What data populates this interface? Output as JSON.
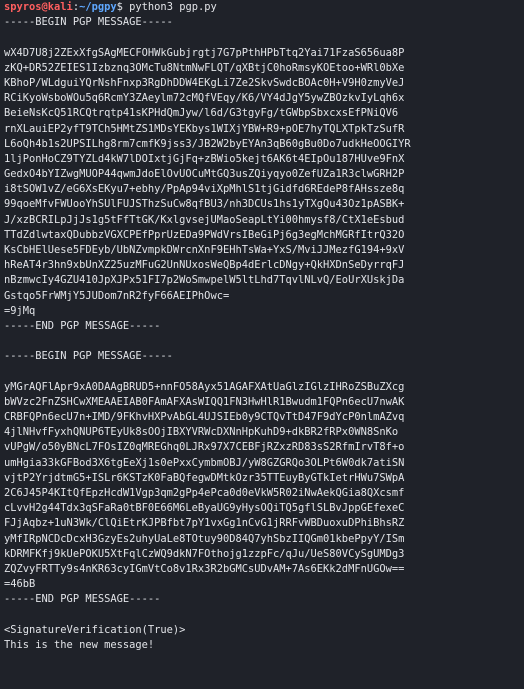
{
  "prompt": {
    "user_host": "spyros@kali",
    "separator": ":",
    "path": "~/pgpy",
    "dollar": "$ ",
    "command": "python3 pgp.py"
  },
  "message_block": {
    "begin": "-----BEGIN PGP MESSAGE-----",
    "lines": [
      "wX4D7U8j2ZExXfgSAgMECFOHWkGubjrgtj7G7pPthHPbTtq2Yai71FzaS656ua8P",
      "zKQ+DR52ZEIES1Izbznq3OMcTu8NtmNwFLQT/qXBtjC0hoRmsyKOEtoo+WRl0bXe",
      "KBhoP/WLdguiYQrNshFnxp3RgDhDDW4EKgLi7Ze2SkvSwdcBOAc0H+V9H0zmyVeJ",
      "RCiKyoWsboWOu5q6RcmY3ZAeylm72cMQfVEqy/K6/VY4dJgY5ywZBOzkvIyLqh6x",
      "BeieNsKcQ51RCQtrqtp41sKPHdQmJyw/l6d/G3tgyFg/tGWbpSbxcxsEfPNiQV6",
      "rnXLauiEP2yfT9TCh5HMtZS1MDsYEKbys1WIXjYBW+R9+pOE7hyTQLXTpkTzSufR",
      "L6oQh4b1s2UPSILhg8rm7cmfK9jss3/JB2W2byEYAn3qB60gBu0Do7udkHeOOGIYR",
      "1ljPonHoCZ9TYZLd4kW7lDOIxtjGjFq+zBWio5kejt6AK6t4EIpOu187HUve9FnX",
      "GedxO4bYIZwgMUOP44qwmJdoElOvUOCuMtGQ3usZQiyqyo0ZefUZa1R3clwGRH2P",
      "i8tSOW1vZ/eG6XsEKyu7+ebhy/PpAp94viXpMhlS1tjGidfd6REdeP8fAHssze8q",
      "99qoeMfvFWUooYhSUlFUJSThzSuCw8qfBU3/nh3DCUs1hs1yTXgQu43Oz1pASBK+",
      "J/xzBCRILpJjJs1g5tFfTtGK/KxlgvsejUMaoSeapLtYi00hmysf8/CtX1eEsbud",
      "TTdZdlwtaxQDubbzVGXCPEfPprUzEDa9PWdVrsIBeGiPj6g3egMchMGRfItrQ32O",
      "KsCbHElUese5FDEyb/UbNZvmpkDWrcnXnF9EHhTsWa+YxS/MviJJMezfG194+9xV",
      "hReAT4r3hn9xbUnXZ25uzMFuG2UnNUxosWeQBp4dErlcDNgy+QkHXDnSeDyrrqFJ",
      "nBzmwcIy4GZU410JpXJPx51FI7p2WoSmwpelW5ltLhd7TqvlNLvQ/EoUrXUskjDa",
      "Gstqo5FrWMjY5JUDom7nR2fyF66AEIPhOwc=",
      "=9jMq"
    ],
    "end": "-----END PGP MESSAGE-----"
  },
  "signature_block": {
    "begin": "-----BEGIN PGP MESSAGE-----",
    "lines": [
      "yMGrAQFlApr9xA0DAAgBRUD5+nnFO58Ayx51AGAFXAtUaGlzIGlzIHRoZSBuZXcg",
      "bWVzc2FnZSHCwXMEAAEIAB0FAmAFXAsWIQQ1FN3HwHlR1Bwudm1FQPn6ecU7nwAK",
      "CRBFQPn6ecU7n+IMD/9FKhvHXPvAbGL4UJSIEb0y9CTQvTtD47F9dYcP0nlmAZvq",
      "4jlNHvfFyxhQNUP6TEyUk8sOOjIBXYVRWcDXNnHpKuhD9+dkBR2fRPx0WN8SnKo",
      "vUPgW/o50yBNcL7FOsIZ0qMREGhq0LJRx97X7CEBFjRZxzRD83sS2RfmIrvT8f+o",
      "umHgia33kGFBod3X6tgEeXj1s0ePxxCymbmOBJ/yW8GZGRQo3OLPt6W0dk7atiSN",
      "vjtP2YrjdtmG5+ISLr6KSTzK0FaBQfegwDMtkOzr35TTEuyByGTkIetrHWu7SWpA",
      "2C6J45P4KItQfEpzHcdW1Vgp3qm2gPp4ePca0d0eVkW5R02iNwAekQGia8QXcsmf",
      "cLvvH2g44Tdx3qSFaRa0tBF0E66M6LeByaUG9yHysOQiTQ5gflSLBvJppGEfexeC",
      "FJjAqbz+1uN3Wk/ClQiEtrKJPBfbt7pY1vxGg1nCvG1jRRFvWBDuoxuDPhiBhsRZ",
      "yMfIRpNCDcDcxH3GzyEs2uhyUaLe8TOtuy90D84Q7yhSbzIIQGm01kbePpyY/ISm",
      "kDRMFKfj9kUePOKU5XtFqlCzWQ9dkN7FOthojg1zzpFc/qJu/UeS80VCySgUMDg3",
      "ZQZvyFRTTy9s4nKR63cyIGmVtCo8v1Rx3R2bGMCsUDvAM+7As6EKk2dMFnUGOw==",
      "=46bB"
    ],
    "end": "-----END PGP MESSAGE-----"
  },
  "verification": "<SignatureVerification(True)>",
  "output_message": "This is the new message!",
  "colors": {
    "background": "#1f2229",
    "text": "#e2e4e8",
    "user_host": "#ff5f5f",
    "path": "#5fa8ff"
  }
}
